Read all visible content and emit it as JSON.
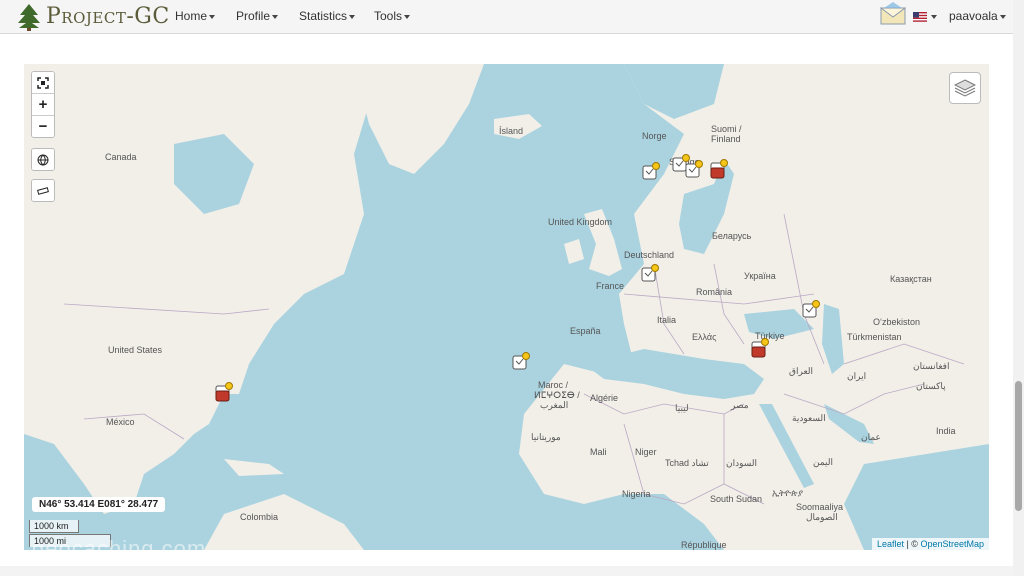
{
  "navbar": {
    "brand": "Project-GC",
    "menu": [
      {
        "label": "Home"
      },
      {
        "label": "Profile"
      },
      {
        "label": "Statistics"
      },
      {
        "label": "Tools"
      }
    ],
    "username": "paavoala"
  },
  "map": {
    "zoom_in": "+",
    "zoom_out": "−",
    "coordinates": "N46° 53.414 E081° 28.477",
    "scale_km": "1000 km",
    "scale_mi": "1000 mi",
    "attribution_leaflet": "Leaflet",
    "attribution_sep": " | © ",
    "attribution_osm": "OpenStreetMap",
    "watermark": "geocaching.com",
    "labels": {
      "island": "Ísland",
      "norge": "Norge",
      "suomi": "Suomi /",
      "finland": "Finland",
      "sverige": "Sverige",
      "canada": "Canada",
      "uk": "United Kingdom",
      "deutschland": "Deutschland",
      "belarus": "Беларусь",
      "ukraina": "Україна",
      "kazakhstan": "Казақстан",
      "france": "France",
      "romania": "România",
      "italia": "Italia",
      "espana": "España",
      "ellas": "Ελλάς",
      "turkiye": "Türkiye",
      "ozbekiston": "O‘zbekiston",
      "turkmenistan": "Türkmenistan",
      "usa": "United States",
      "maroc": "Maroc /",
      "maroc2": "ⵍⵎⵖⵔⵉⴱ /",
      "maroc3": "المغرب",
      "algerie": "Algérie",
      "libya": "ليبيا",
      "misr": "مصر",
      "iraq": "العراق",
      "iran": "ایران",
      "afghanistan": "افغانستان",
      "pakistan": "پاکستان",
      "saudi": "السعودية",
      "oman": "عمان",
      "india": "India",
      "yemen": "اليمن",
      "mexico": "México",
      "mauritania": "موريتانيا",
      "mali": "Mali",
      "niger": "Niger",
      "tchad": "Tchad تشاد",
      "sudan": "السودان",
      "nigeria": "Nigeria",
      "southsudan": "South Sudan",
      "ethiopia": "ኢትዮጵያ",
      "somalia": "Soomaaliya",
      "somalia2": "الصومال",
      "colombia": "Colombia",
      "republique": "République"
    }
  },
  "colors": {
    "water": "#aad3df",
    "land": "#f2efe9",
    "accent_link": "#0078a8"
  }
}
